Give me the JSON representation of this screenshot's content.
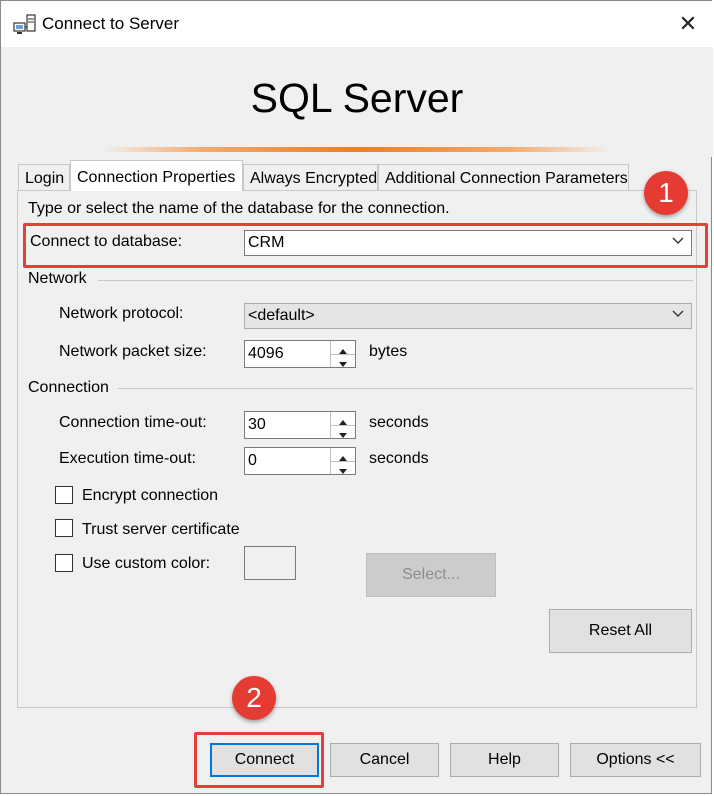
{
  "window": {
    "title": "Connect to Server",
    "close_glyph": "✕"
  },
  "banner": {
    "title": "SQL Server"
  },
  "tabs": [
    {
      "label": "Login",
      "active": false
    },
    {
      "label": "Connection Properties",
      "active": true
    },
    {
      "label": "Always Encrypted",
      "active": false
    },
    {
      "label": "Additional Connection Parameters",
      "active": false
    }
  ],
  "connection_properties": {
    "instruction": "Type or select the name of the database for the connection.",
    "connect_to_database": {
      "label": "Connect to database:",
      "value": "CRM"
    },
    "network": {
      "section_label": "Network",
      "protocol": {
        "label": "Network protocol:",
        "value": "<default>"
      },
      "packet_size": {
        "label": "Network packet size:",
        "value": "4096",
        "unit": "bytes"
      }
    },
    "connection": {
      "section_label": "Connection",
      "timeout": {
        "label": "Connection time-out:",
        "value": "30",
        "unit": "seconds"
      },
      "execution_timeout": {
        "label": "Execution time-out:",
        "value": "0",
        "unit": "seconds"
      }
    },
    "encrypt_connection": {
      "label": "Encrypt connection",
      "checked": false
    },
    "trust_server_certificate": {
      "label": "Trust server certificate",
      "checked": false
    },
    "use_custom_color": {
      "label": "Use custom color:",
      "checked": false
    },
    "select_button": "Select...",
    "reset_all_button": "Reset All"
  },
  "footer_buttons": {
    "connect": "Connect",
    "cancel": "Cancel",
    "help": "Help",
    "options": "Options <<"
  },
  "annotations": {
    "badge_1": "1",
    "badge_2": "2",
    "highlight_color": "#e53f3a"
  },
  "icons": {
    "app": "server-connect-icon",
    "close": "close-icon",
    "dropdown": "chevron-down-icon"
  },
  "colors": {
    "accent": "#ef7d22",
    "focus": "#0078d7"
  }
}
